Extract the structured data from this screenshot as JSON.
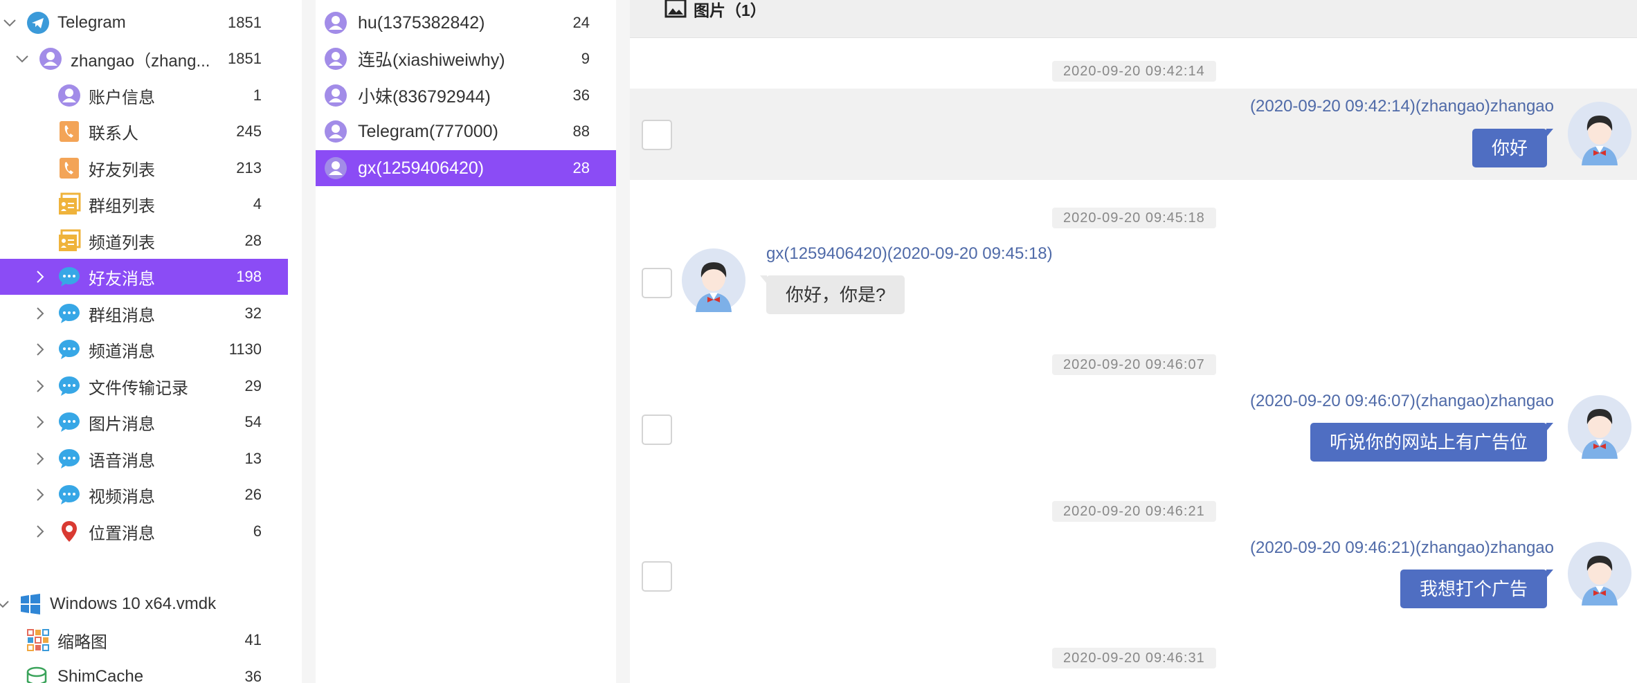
{
  "colors": {
    "selected": "#8b4cf5",
    "bubble_out": "#4f6ec2",
    "bubble_in": "#e9e9e9",
    "sender_text": "#4f6aa8"
  },
  "tree": {
    "items": [
      {
        "label": "Telegram",
        "count": "1851",
        "icon": "telegram-icon"
      },
      {
        "label": "zhangao（zhang...",
        "count": "1851",
        "icon": "user-icon"
      },
      {
        "label": "账户信息",
        "count": "1",
        "icon": "user-icon"
      },
      {
        "label": "联系人",
        "count": "245",
        "icon": "phone-icon"
      },
      {
        "label": "好友列表",
        "count": "213",
        "icon": "phone-icon"
      },
      {
        "label": "群组列表",
        "count": "4",
        "icon": "contact-card-icon"
      },
      {
        "label": "频道列表",
        "count": "28",
        "icon": "contact-card-icon"
      },
      {
        "label": "好友消息",
        "count": "198",
        "icon": "chat-bubble-icon",
        "selected": true
      },
      {
        "label": "群组消息",
        "count": "32",
        "icon": "chat-bubble-icon"
      },
      {
        "label": "频道消息",
        "count": "1130",
        "icon": "chat-bubble-icon"
      },
      {
        "label": "文件传输记录",
        "count": "29",
        "icon": "chat-bubble-icon"
      },
      {
        "label": "图片消息",
        "count": "54",
        "icon": "chat-bubble-icon"
      },
      {
        "label": "语音消息",
        "count": "13",
        "icon": "chat-bubble-icon"
      },
      {
        "label": "视频消息",
        "count": "26",
        "icon": "chat-bubble-icon"
      },
      {
        "label": "位置消息",
        "count": "6",
        "icon": "location-pin-icon"
      },
      {
        "label": "Windows 10 x64.vmdk",
        "count": "",
        "icon": "windows-icon"
      },
      {
        "label": "缩略图",
        "count": "41",
        "icon": "thumbnail-grid-icon"
      },
      {
        "label": "ShimCache",
        "count": "36",
        "icon": "cache-icon"
      }
    ]
  },
  "contacts": [
    {
      "label": "hu(1375382842)",
      "count": "24"
    },
    {
      "label": "连弘(xiashiweiwhy)",
      "count": "9"
    },
    {
      "label": "小妹(836792944)",
      "count": "36"
    },
    {
      "label": "Telegram(777000)",
      "count": "88"
    },
    {
      "label": "gx(1259406420)",
      "count": "28",
      "selected": true
    }
  ],
  "chat": {
    "header": {
      "label": "图片（1）",
      "icon": "image-icon"
    },
    "messages": [
      {
        "time": "2020-09-20 09:42:14",
        "direction": "out",
        "sender": "(2020-09-20 09:42:14)(zhangao)zhangao",
        "text": "你好"
      },
      {
        "time": "2020-09-20 09:45:18",
        "direction": "in",
        "sender": "gx(1259406420)(2020-09-20 09:45:18)",
        "text": "你好，你是?"
      },
      {
        "time": "2020-09-20 09:46:07",
        "direction": "out",
        "sender": "(2020-09-20 09:46:07)(zhangao)zhangao",
        "text": "听说你的网站上有广告位"
      },
      {
        "time": "2020-09-20 09:46:21",
        "direction": "out",
        "sender": "(2020-09-20 09:46:21)(zhangao)zhangao",
        "text": "我想打个广告"
      }
    ],
    "trailing_time": "2020-09-20 09:46:31"
  }
}
